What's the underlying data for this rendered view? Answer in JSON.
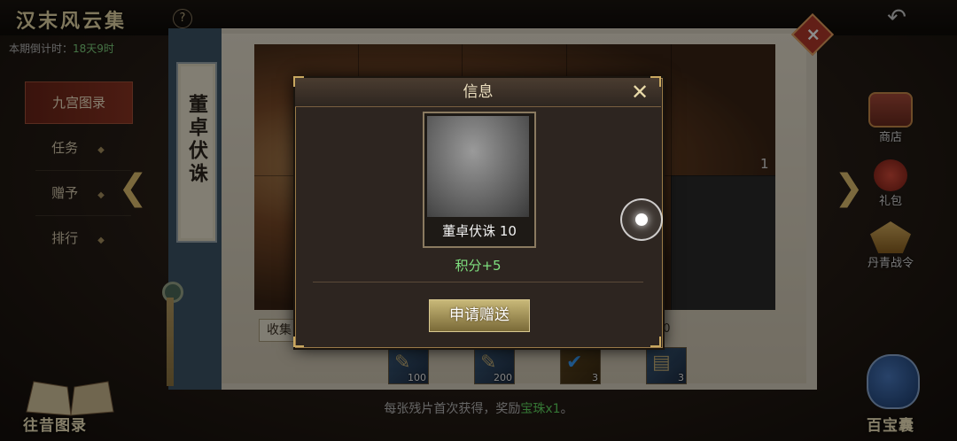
{
  "header": {
    "title": "汉末风云集",
    "help_icon_glyph": "?",
    "back_icon": "back-arrow-icon",
    "countdown_label": "本期倒计时：",
    "countdown_value": "18天9时"
  },
  "left_nav": {
    "items": [
      {
        "label": "九宫图录",
        "active": true
      },
      {
        "label": "任务",
        "active": false
      },
      {
        "label": "赠予",
        "active": false
      },
      {
        "label": "排行",
        "active": false
      }
    ],
    "bottom_button_label": "往昔图录"
  },
  "panel": {
    "scroll_title": "董卓伏诛",
    "grid_cell_count": "1",
    "collect_chip": "收集",
    "right_chip": "10",
    "rewards": [
      {
        "icon": "scroll-quill-icon",
        "count": "100"
      },
      {
        "icon": "scroll-quill-icon",
        "count": "200"
      },
      {
        "icon": "checkmark-badge-icon",
        "count": "3"
      },
      {
        "icon": "scroll-map-icon",
        "count": "3"
      }
    ],
    "hint_prefix": "每张残片首次获得，奖励",
    "hint_highlight": "宝珠x1",
    "hint_suffix": "。"
  },
  "right_menu": {
    "items": [
      {
        "label": "商店",
        "icon": "shop-chest-icon"
      },
      {
        "label": "礼包",
        "icon": "gift-pack-icon"
      },
      {
        "label": "丹青战令",
        "icon": "battle-pass-icon"
      }
    ],
    "treasure_label": "百宝囊"
  },
  "modal": {
    "title": "信息",
    "close_glyph": "✕",
    "card_name": "董卓伏诛 10",
    "points_text": "积分+5",
    "request_button": "申请赠送"
  },
  "colors": {
    "accent_gold": "#c9a860",
    "points_green": "#7fe07f",
    "nav_active": "#8b3422",
    "spine_blue": "#3d5466"
  }
}
